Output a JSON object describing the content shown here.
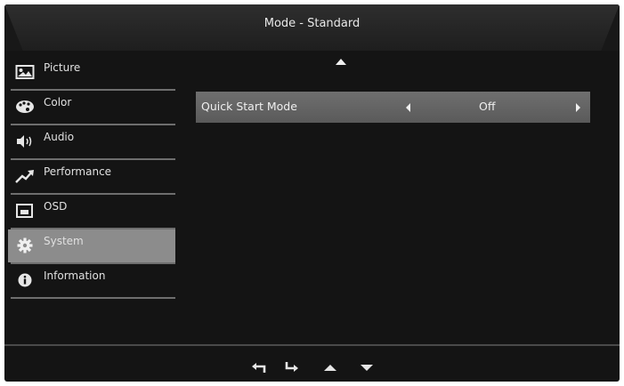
{
  "header": {
    "title": "Mode - Standard"
  },
  "sidebar": {
    "items": [
      {
        "label": "Picture",
        "icon": "picture-icon",
        "selected": false
      },
      {
        "label": "Color",
        "icon": "color-palette-icon",
        "selected": false
      },
      {
        "label": "Audio",
        "icon": "speaker-icon",
        "selected": false
      },
      {
        "label": "Performance",
        "icon": "performance-arrow-icon",
        "selected": false
      },
      {
        "label": "OSD",
        "icon": "osd-window-icon",
        "selected": false
      },
      {
        "label": "System",
        "icon": "gear-icon",
        "selected": true
      },
      {
        "label": "Information",
        "icon": "info-icon",
        "selected": false
      }
    ]
  },
  "main": {
    "setting": {
      "label": "Quick Start Mode",
      "value": "Off"
    }
  },
  "footer": {
    "buttons": [
      "back-icon",
      "enter-icon",
      "up-arrow-icon",
      "down-arrow-icon"
    ]
  },
  "colors": {
    "background": "#141414",
    "selected_item": "#8c8c8c",
    "setting_row": "#666666",
    "text": "#e0e0e0"
  }
}
